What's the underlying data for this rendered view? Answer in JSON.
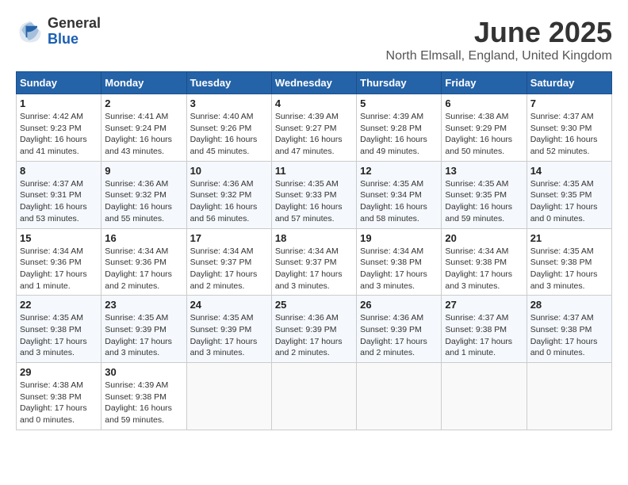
{
  "logo": {
    "general": "General",
    "blue": "Blue"
  },
  "title": {
    "month_year": "June 2025",
    "location": "North Elmsall, England, United Kingdom"
  },
  "weekdays": [
    "Sunday",
    "Monday",
    "Tuesday",
    "Wednesday",
    "Thursday",
    "Friday",
    "Saturday"
  ],
  "weeks": [
    [
      {
        "day": "1",
        "sunrise": "4:42 AM",
        "sunset": "9:23 PM",
        "daylight": "16 hours and 41 minutes."
      },
      {
        "day": "2",
        "sunrise": "4:41 AM",
        "sunset": "9:24 PM",
        "daylight": "16 hours and 43 minutes."
      },
      {
        "day": "3",
        "sunrise": "4:40 AM",
        "sunset": "9:26 PM",
        "daylight": "16 hours and 45 minutes."
      },
      {
        "day": "4",
        "sunrise": "4:39 AM",
        "sunset": "9:27 PM",
        "daylight": "16 hours and 47 minutes."
      },
      {
        "day": "5",
        "sunrise": "4:39 AM",
        "sunset": "9:28 PM",
        "daylight": "16 hours and 49 minutes."
      },
      {
        "day": "6",
        "sunrise": "4:38 AM",
        "sunset": "9:29 PM",
        "daylight": "16 hours and 50 minutes."
      },
      {
        "day": "7",
        "sunrise": "4:37 AM",
        "sunset": "9:30 PM",
        "daylight": "16 hours and 52 minutes."
      }
    ],
    [
      {
        "day": "8",
        "sunrise": "4:37 AM",
        "sunset": "9:31 PM",
        "daylight": "16 hours and 53 minutes."
      },
      {
        "day": "9",
        "sunrise": "4:36 AM",
        "sunset": "9:32 PM",
        "daylight": "16 hours and 55 minutes."
      },
      {
        "day": "10",
        "sunrise": "4:36 AM",
        "sunset": "9:32 PM",
        "daylight": "16 hours and 56 minutes."
      },
      {
        "day": "11",
        "sunrise": "4:35 AM",
        "sunset": "9:33 PM",
        "daylight": "16 hours and 57 minutes."
      },
      {
        "day": "12",
        "sunrise": "4:35 AM",
        "sunset": "9:34 PM",
        "daylight": "16 hours and 58 minutes."
      },
      {
        "day": "13",
        "sunrise": "4:35 AM",
        "sunset": "9:35 PM",
        "daylight": "16 hours and 59 minutes."
      },
      {
        "day": "14",
        "sunrise": "4:35 AM",
        "sunset": "9:35 PM",
        "daylight": "17 hours and 0 minutes."
      }
    ],
    [
      {
        "day": "15",
        "sunrise": "4:34 AM",
        "sunset": "9:36 PM",
        "daylight": "17 hours and 1 minute."
      },
      {
        "day": "16",
        "sunrise": "4:34 AM",
        "sunset": "9:36 PM",
        "daylight": "17 hours and 2 minutes."
      },
      {
        "day": "17",
        "sunrise": "4:34 AM",
        "sunset": "9:37 PM",
        "daylight": "17 hours and 2 minutes."
      },
      {
        "day": "18",
        "sunrise": "4:34 AM",
        "sunset": "9:37 PM",
        "daylight": "17 hours and 3 minutes."
      },
      {
        "day": "19",
        "sunrise": "4:34 AM",
        "sunset": "9:38 PM",
        "daylight": "17 hours and 3 minutes."
      },
      {
        "day": "20",
        "sunrise": "4:34 AM",
        "sunset": "9:38 PM",
        "daylight": "17 hours and 3 minutes."
      },
      {
        "day": "21",
        "sunrise": "4:35 AM",
        "sunset": "9:38 PM",
        "daylight": "17 hours and 3 minutes."
      }
    ],
    [
      {
        "day": "22",
        "sunrise": "4:35 AM",
        "sunset": "9:38 PM",
        "daylight": "17 hours and 3 minutes."
      },
      {
        "day": "23",
        "sunrise": "4:35 AM",
        "sunset": "9:39 PM",
        "daylight": "17 hours and 3 minutes."
      },
      {
        "day": "24",
        "sunrise": "4:35 AM",
        "sunset": "9:39 PM",
        "daylight": "17 hours and 3 minutes."
      },
      {
        "day": "25",
        "sunrise": "4:36 AM",
        "sunset": "9:39 PM",
        "daylight": "17 hours and 2 minutes."
      },
      {
        "day": "26",
        "sunrise": "4:36 AM",
        "sunset": "9:39 PM",
        "daylight": "17 hours and 2 minutes."
      },
      {
        "day": "27",
        "sunrise": "4:37 AM",
        "sunset": "9:38 PM",
        "daylight": "17 hours and 1 minute."
      },
      {
        "day": "28",
        "sunrise": "4:37 AM",
        "sunset": "9:38 PM",
        "daylight": "17 hours and 0 minutes."
      }
    ],
    [
      {
        "day": "29",
        "sunrise": "4:38 AM",
        "sunset": "9:38 PM",
        "daylight": "17 hours and 0 minutes."
      },
      {
        "day": "30",
        "sunrise": "4:39 AM",
        "sunset": "9:38 PM",
        "daylight": "16 hours and 59 minutes."
      },
      null,
      null,
      null,
      null,
      null
    ]
  ]
}
